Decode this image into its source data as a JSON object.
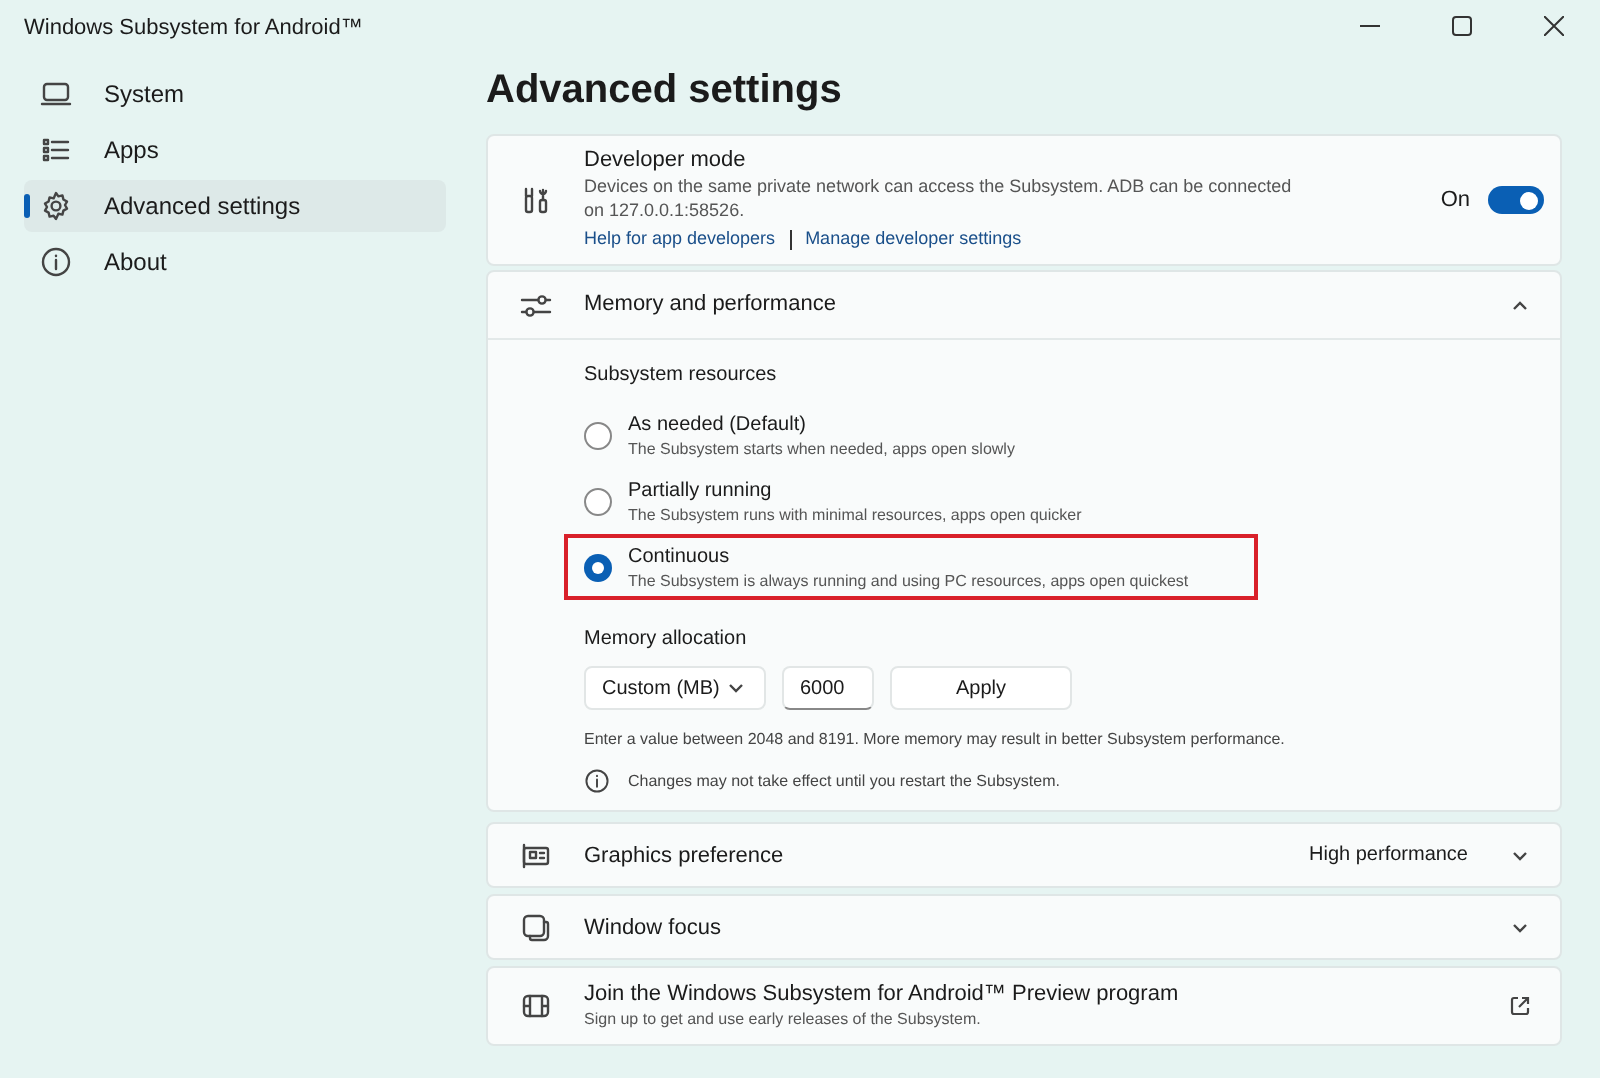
{
  "window": {
    "title": "Windows Subsystem for Android™"
  },
  "sidebar": {
    "items": [
      {
        "label": "System",
        "selected": false
      },
      {
        "label": "Apps",
        "selected": false
      },
      {
        "label": "Advanced settings",
        "selected": true
      },
      {
        "label": "About",
        "selected": false
      }
    ]
  },
  "page_title": "Advanced settings",
  "developer_mode": {
    "title": "Developer mode",
    "description": "Devices on the same private network can access the Subsystem. ADB can be connected on 127.0.0.1:58526.",
    "links": [
      "Help for app developers",
      "Manage developer settings"
    ],
    "toggle_label": "On",
    "on": true
  },
  "memory": {
    "title": "Memory and performance",
    "expanded": true,
    "resources_label": "Subsystem resources",
    "options": [
      {
        "label": "As needed (Default)",
        "description": "The Subsystem starts when needed, apps open slowly",
        "selected": false,
        "highlighted": false
      },
      {
        "label": "Partially running",
        "description": "The Subsystem runs with minimal resources, apps open quicker",
        "selected": false,
        "highlighted": false
      },
      {
        "label": "Continuous",
        "description": "The Subsystem is always running and using PC resources, apps open quickest",
        "selected": true,
        "highlighted": true
      }
    ],
    "allocation_label": "Memory allocation",
    "dropdown": "Custom (MB)",
    "value": "6000",
    "apply": "Apply",
    "hint": "Enter a value between 2048 and 8191. More memory may result in better Subsystem performance.",
    "note": "Changes may not take effect until you restart the Subsystem."
  },
  "rows": [
    {
      "kind": "dropdown",
      "title": "Graphics preference",
      "value": "High performance"
    },
    {
      "kind": "expander",
      "title": "Window focus"
    },
    {
      "kind": "link",
      "title": "Join the Windows Subsystem for Android™ Preview program",
      "description": "Sign up to get and use early releases of the Subsystem."
    }
  ]
}
